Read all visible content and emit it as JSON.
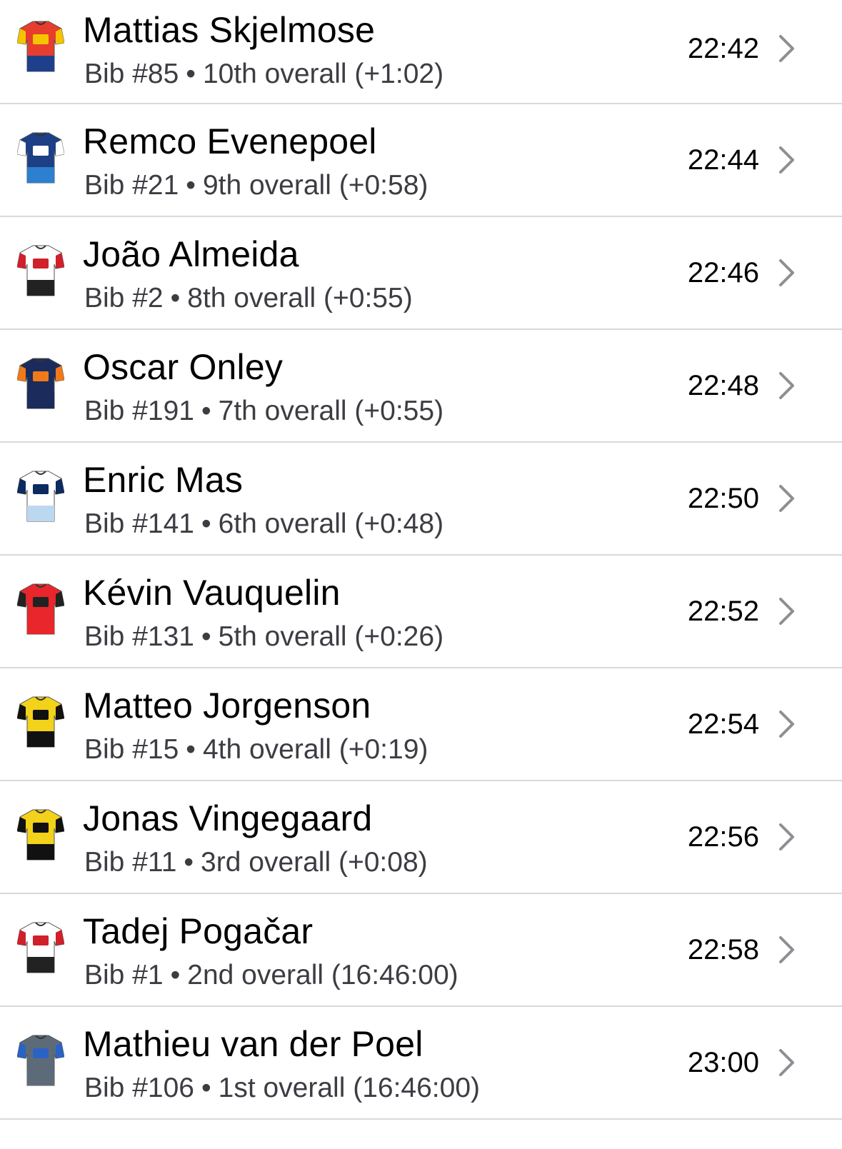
{
  "riders": [
    {
      "name": "Mattias Skjelmose",
      "bib": "Bib #85",
      "overall": "10th overall (+1:02)",
      "time": "22:42",
      "jersey_icon": "lidl-trek-jersey-icon",
      "jersey_colors": {
        "body": "#e63d2e",
        "accent": "#f5c400",
        "bottom": "#1f3f8a"
      }
    },
    {
      "name": "Remco Evenepoel",
      "bib": "Bib #21",
      "overall": "9th overall (+0:58)",
      "time": "22:44",
      "jersey_icon": "soudal-quickstep-jersey-icon",
      "jersey_colors": {
        "body": "#1c3f86",
        "accent": "#ffffff",
        "bottom": "#2d7fd0"
      }
    },
    {
      "name": "João Almeida",
      "bib": "Bib #2",
      "overall": "8th overall (+0:55)",
      "time": "22:46",
      "jersey_icon": "uae-jersey-icon",
      "jersey_colors": {
        "body": "#ffffff",
        "accent": "#d0202a",
        "bottom": "#222222"
      }
    },
    {
      "name": "Oscar Onley",
      "bib": "Bib #191",
      "overall": "7th overall (+0:55)",
      "time": "22:48",
      "jersey_icon": "picnic-postnl-jersey-icon",
      "jersey_colors": {
        "body": "#1b2c5c",
        "accent": "#f07a1a",
        "bottom": "#1b2c5c"
      }
    },
    {
      "name": "Enric Mas",
      "bib": "Bib #141",
      "overall": "6th overall (+0:48)",
      "time": "22:50",
      "jersey_icon": "movistar-jersey-icon",
      "jersey_colors": {
        "body": "#ffffff",
        "accent": "#0d2b5e",
        "bottom": "#bcd7f0"
      }
    },
    {
      "name": "Kévin Vauquelin",
      "bib": "Bib #131",
      "overall": "5th overall (+0:26)",
      "time": "22:52",
      "jersey_icon": "arkea-jersey-icon",
      "jersey_colors": {
        "body": "#e8262b",
        "accent": "#222222",
        "bottom": "#e8262b"
      }
    },
    {
      "name": "Matteo Jorgenson",
      "bib": "Bib #15",
      "overall": "4th overall (+0:19)",
      "time": "22:54",
      "jersey_icon": "visma-jersey-icon",
      "jersey_colors": {
        "body": "#f2d21a",
        "accent": "#111111",
        "bottom": "#111111"
      }
    },
    {
      "name": "Jonas Vingegaard",
      "bib": "Bib #11",
      "overall": "3rd overall (+0:08)",
      "time": "22:56",
      "jersey_icon": "visma-jersey-icon",
      "jersey_colors": {
        "body": "#f2d21a",
        "accent": "#111111",
        "bottom": "#111111"
      }
    },
    {
      "name": "Tadej Pogačar",
      "bib": "Bib #1",
      "overall": "2nd overall (16:46:00)",
      "time": "22:58",
      "jersey_icon": "uae-jersey-icon",
      "jersey_colors": {
        "body": "#ffffff",
        "accent": "#d0202a",
        "bottom": "#222222"
      }
    },
    {
      "name": "Mathieu van der Poel",
      "bib": "Bib #106",
      "overall": "1st overall (16:46:00)",
      "time": "23:00",
      "jersey_icon": "alpecin-jersey-icon",
      "jersey_colors": {
        "body": "#5d6b78",
        "accent": "#2b63c4",
        "bottom": "#5d6b78"
      }
    }
  ],
  "separator": "•",
  "chevron_icon": "chevron-right-icon",
  "colors": {
    "text": "#000000",
    "subtext": "#3c3c43",
    "divider": "#d9d9de",
    "chevron": "#8e8e93"
  }
}
